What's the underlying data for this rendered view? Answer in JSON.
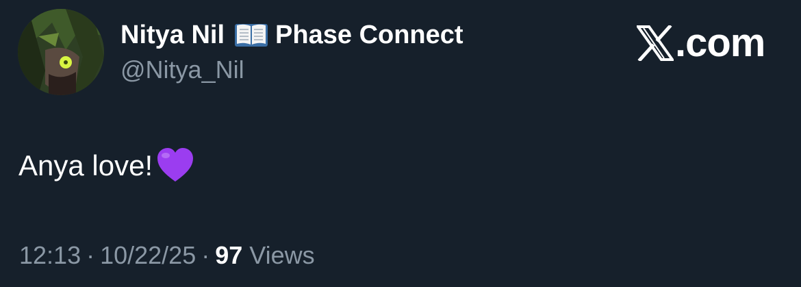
{
  "author": {
    "display_name": "Nitya Nil",
    "org": "Phase Connect",
    "handle": "@Nitya_Nil",
    "badge_icon": "open-book-icon",
    "avatar_icon": "avatar-image"
  },
  "brand": {
    "logo_icon": "x-logo-icon",
    "suffix": ".com"
  },
  "tweet": {
    "text": "Anya love!",
    "emoji_icon": "purple-heart-icon",
    "emoji_color": "#9b3df0"
  },
  "meta": {
    "time": "12:13",
    "separator": "·",
    "date": "10/22/25",
    "views_count": "97",
    "views_label": "Views"
  },
  "colors": {
    "background": "#16202b",
    "primary_text": "#ffffff",
    "secondary_text": "#8b98a5"
  }
}
